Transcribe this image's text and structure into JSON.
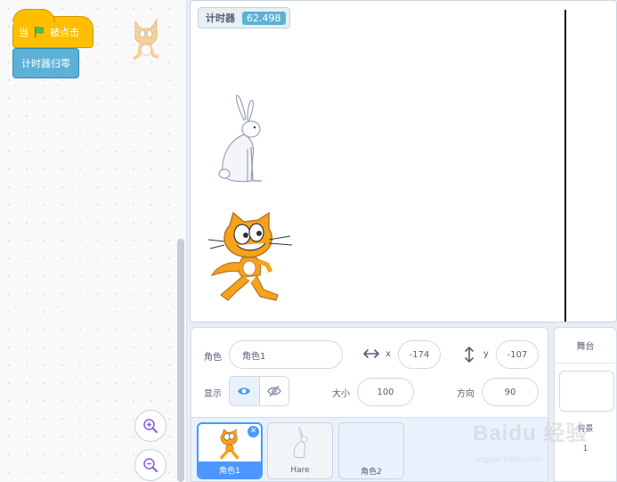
{
  "code_area": {
    "hat_block": {
      "prefix": "当",
      "suffix": "被点击",
      "icon": "green-flag-icon"
    },
    "command_block": {
      "label": "计时器归零"
    }
  },
  "stage": {
    "monitor": {
      "label": "计时器",
      "value": "62.498"
    }
  },
  "sprite_info": {
    "sprite_label": "角色",
    "sprite_name": "角色1",
    "x_label": "x",
    "x_value": "-174",
    "y_label": "y",
    "y_value": "-107",
    "show_label": "显示",
    "size_label": "大小",
    "size_value": "100",
    "direction_label": "方向",
    "direction_value": "90"
  },
  "sprite_list": [
    {
      "name": "角色1",
      "selected": true
    },
    {
      "name": "Hare",
      "selected": false
    },
    {
      "name": "角色2",
      "selected": false
    }
  ],
  "stage_panel": {
    "title": "舞台",
    "backdrop_label": "背景",
    "backdrop_count": "1"
  },
  "watermark": {
    "text": "Baidu 经验",
    "sub": "jingyan.baidu.com"
  },
  "colors": {
    "event": "#ffbf00",
    "sensing": "#5cb1d6",
    "accent": "#4c97ff"
  }
}
